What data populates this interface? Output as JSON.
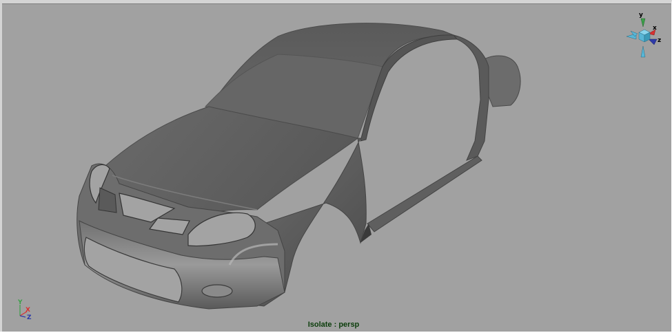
{
  "viewport": {
    "status_label": "Isolate : persp",
    "background_color": "#a1a1a1",
    "label_color": "#0b3d0b"
  },
  "view_cube": {
    "y_label": "y",
    "x_label": "x",
    "z_label": "z",
    "y_color": "#3ca04a",
    "x_color": "#d83030",
    "z_color": "#2e3aa8",
    "cube_color": "#58b6d6"
  },
  "axis_indicator": {
    "y_label": "Y",
    "x_label": "X",
    "z_label": "Z"
  },
  "scene": {
    "object": "car-body-shell",
    "material_color": "#6b6b6b"
  }
}
